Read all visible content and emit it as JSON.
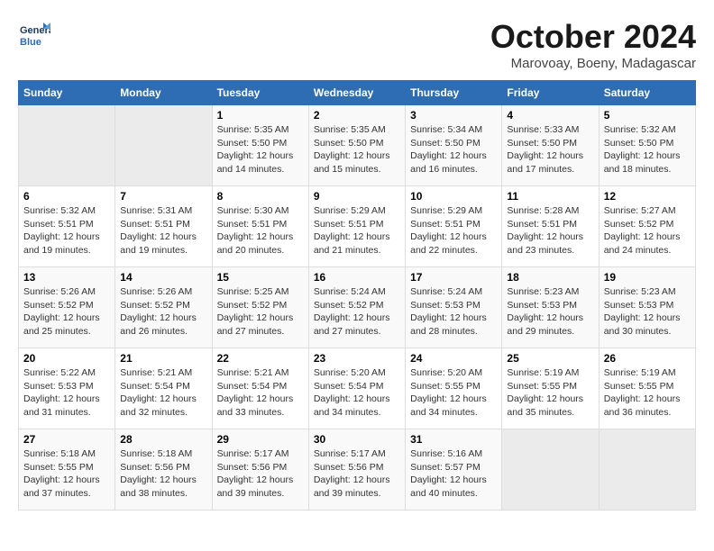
{
  "header": {
    "logo_line1": "General",
    "logo_line2": "Blue",
    "month_title": "October 2024",
    "subtitle": "Marovoay, Boeny, Madagascar"
  },
  "days_of_week": [
    "Sunday",
    "Monday",
    "Tuesday",
    "Wednesday",
    "Thursday",
    "Friday",
    "Saturday"
  ],
  "weeks": [
    [
      {
        "num": "",
        "sunrise": "",
        "sunset": "",
        "daylight": ""
      },
      {
        "num": "",
        "sunrise": "",
        "sunset": "",
        "daylight": ""
      },
      {
        "num": "1",
        "sunrise": "5:35 AM",
        "sunset": "5:50 PM",
        "daylight": "12 hours and 14 minutes."
      },
      {
        "num": "2",
        "sunrise": "5:35 AM",
        "sunset": "5:50 PM",
        "daylight": "12 hours and 15 minutes."
      },
      {
        "num": "3",
        "sunrise": "5:34 AM",
        "sunset": "5:50 PM",
        "daylight": "12 hours and 16 minutes."
      },
      {
        "num": "4",
        "sunrise": "5:33 AM",
        "sunset": "5:50 PM",
        "daylight": "12 hours and 17 minutes."
      },
      {
        "num": "5",
        "sunrise": "5:32 AM",
        "sunset": "5:50 PM",
        "daylight": "12 hours and 18 minutes."
      }
    ],
    [
      {
        "num": "6",
        "sunrise": "5:32 AM",
        "sunset": "5:51 PM",
        "daylight": "12 hours and 19 minutes."
      },
      {
        "num": "7",
        "sunrise": "5:31 AM",
        "sunset": "5:51 PM",
        "daylight": "12 hours and 19 minutes."
      },
      {
        "num": "8",
        "sunrise": "5:30 AM",
        "sunset": "5:51 PM",
        "daylight": "12 hours and 20 minutes."
      },
      {
        "num": "9",
        "sunrise": "5:29 AM",
        "sunset": "5:51 PM",
        "daylight": "12 hours and 21 minutes."
      },
      {
        "num": "10",
        "sunrise": "5:29 AM",
        "sunset": "5:51 PM",
        "daylight": "12 hours and 22 minutes."
      },
      {
        "num": "11",
        "sunrise": "5:28 AM",
        "sunset": "5:51 PM",
        "daylight": "12 hours and 23 minutes."
      },
      {
        "num": "12",
        "sunrise": "5:27 AM",
        "sunset": "5:52 PM",
        "daylight": "12 hours and 24 minutes."
      }
    ],
    [
      {
        "num": "13",
        "sunrise": "5:26 AM",
        "sunset": "5:52 PM",
        "daylight": "12 hours and 25 minutes."
      },
      {
        "num": "14",
        "sunrise": "5:26 AM",
        "sunset": "5:52 PM",
        "daylight": "12 hours and 26 minutes."
      },
      {
        "num": "15",
        "sunrise": "5:25 AM",
        "sunset": "5:52 PM",
        "daylight": "12 hours and 27 minutes."
      },
      {
        "num": "16",
        "sunrise": "5:24 AM",
        "sunset": "5:52 PM",
        "daylight": "12 hours and 27 minutes."
      },
      {
        "num": "17",
        "sunrise": "5:24 AM",
        "sunset": "5:53 PM",
        "daylight": "12 hours and 28 minutes."
      },
      {
        "num": "18",
        "sunrise": "5:23 AM",
        "sunset": "5:53 PM",
        "daylight": "12 hours and 29 minutes."
      },
      {
        "num": "19",
        "sunrise": "5:23 AM",
        "sunset": "5:53 PM",
        "daylight": "12 hours and 30 minutes."
      }
    ],
    [
      {
        "num": "20",
        "sunrise": "5:22 AM",
        "sunset": "5:53 PM",
        "daylight": "12 hours and 31 minutes."
      },
      {
        "num": "21",
        "sunrise": "5:21 AM",
        "sunset": "5:54 PM",
        "daylight": "12 hours and 32 minutes."
      },
      {
        "num": "22",
        "sunrise": "5:21 AM",
        "sunset": "5:54 PM",
        "daylight": "12 hours and 33 minutes."
      },
      {
        "num": "23",
        "sunrise": "5:20 AM",
        "sunset": "5:54 PM",
        "daylight": "12 hours and 34 minutes."
      },
      {
        "num": "24",
        "sunrise": "5:20 AM",
        "sunset": "5:55 PM",
        "daylight": "12 hours and 34 minutes."
      },
      {
        "num": "25",
        "sunrise": "5:19 AM",
        "sunset": "5:55 PM",
        "daylight": "12 hours and 35 minutes."
      },
      {
        "num": "26",
        "sunrise": "5:19 AM",
        "sunset": "5:55 PM",
        "daylight": "12 hours and 36 minutes."
      }
    ],
    [
      {
        "num": "27",
        "sunrise": "5:18 AM",
        "sunset": "5:55 PM",
        "daylight": "12 hours and 37 minutes."
      },
      {
        "num": "28",
        "sunrise": "5:18 AM",
        "sunset": "5:56 PM",
        "daylight": "12 hours and 38 minutes."
      },
      {
        "num": "29",
        "sunrise": "5:17 AM",
        "sunset": "5:56 PM",
        "daylight": "12 hours and 39 minutes."
      },
      {
        "num": "30",
        "sunrise": "5:17 AM",
        "sunset": "5:56 PM",
        "daylight": "12 hours and 39 minutes."
      },
      {
        "num": "31",
        "sunrise": "5:16 AM",
        "sunset": "5:57 PM",
        "daylight": "12 hours and 40 minutes."
      },
      {
        "num": "",
        "sunrise": "",
        "sunset": "",
        "daylight": ""
      },
      {
        "num": "",
        "sunrise": "",
        "sunset": "",
        "daylight": ""
      }
    ]
  ],
  "labels": {
    "sunrise": "Sunrise:",
    "sunset": "Sunset:",
    "daylight": "Daylight:"
  }
}
